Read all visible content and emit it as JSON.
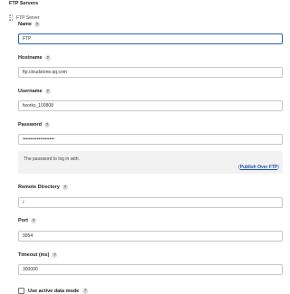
{
  "section": {
    "title": "FTP Servers",
    "server_label": "FTP Server"
  },
  "help_glyph": "?",
  "fields": {
    "name": {
      "label": "Name",
      "value": "FTP"
    },
    "hostname": {
      "label": "Hostname",
      "value": "ftp.cloudstone.qq.com"
    },
    "username": {
      "label": "Username",
      "value": "fworks_100808"
    },
    "password": {
      "label": "Password",
      "value": "••••••••••••••••••••"
    },
    "remote_directory": {
      "label": "Remote Directory",
      "value": "/"
    },
    "port": {
      "label": "Port",
      "value": "9054"
    },
    "timeout": {
      "label": "Timeout (ms)",
      "value": "300000"
    }
  },
  "password_help": {
    "text": "The password to log in with.",
    "link_open": "(",
    "link_text": "Publish Over FTP",
    "link_close": ")"
  },
  "active_mode": {
    "label": "Use active data mode",
    "checked": false
  },
  "colors": {
    "focus_border": "#2b63c4",
    "link": "#1d4fa8",
    "help_bg": "#f2f2f2"
  }
}
